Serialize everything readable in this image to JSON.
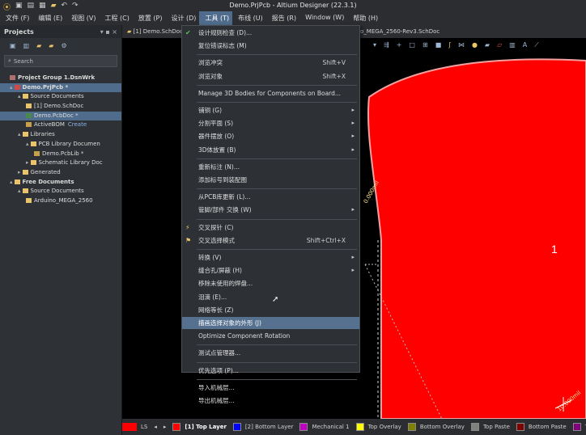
{
  "app": {
    "title": "Demo.PrjPcb - Altium Designer (22.3.1)"
  },
  "menubar": {
    "items": [
      {
        "label": "文件 (F)"
      },
      {
        "label": "编辑 (E)"
      },
      {
        "label": "视图 (V)"
      },
      {
        "label": "工程 (C)"
      },
      {
        "label": "放置 (P)"
      },
      {
        "label": "设计 (D)"
      },
      {
        "label": "工具 (T)",
        "active": true
      },
      {
        "label": "布线 (U)"
      },
      {
        "label": "报告 (R)"
      },
      {
        "label": "Window (W)"
      },
      {
        "label": "帮助 (H)"
      }
    ]
  },
  "projects_panel": {
    "title": "Projects",
    "controls": "▾ ▪ ×",
    "search_placeholder": "Search",
    "tree": [
      {
        "label": "Project Group 1.DsnWrk",
        "indent": 0,
        "bold": true,
        "icon": "workspace-icon"
      },
      {
        "label": "Demo.PrjPcb *",
        "indent": 0,
        "bold": true,
        "selected": true,
        "arrow": "▴",
        "icon": "project-icon"
      },
      {
        "label": "Source Documents",
        "indent": 1,
        "arrow": "▴",
        "icon": "folder-icon"
      },
      {
        "label": "[1] Demo.SchDoc",
        "indent": 2,
        "icon": "schematic-icon"
      },
      {
        "label": "Demo.PcbDoc *",
        "indent": 2,
        "selected": true,
        "icon": "pcb-icon"
      },
      {
        "label": "ActiveBOM",
        "indent": 2,
        "extra": "Create",
        "icon": "bom-icon"
      },
      {
        "label": "Libraries",
        "indent": 1,
        "arrow": "▴",
        "icon": "folder-icon"
      },
      {
        "label": "PCB Library Documen",
        "indent": 2,
        "arrow": "▴",
        "icon": "folder-icon"
      },
      {
        "label": "Demo.PcbLib *",
        "indent": 3,
        "icon": "pcblib-icon"
      },
      {
        "label": "Schematic Library Doc",
        "indent": 2,
        "arrow": "▸",
        "icon": "folder-icon"
      },
      {
        "label": "Generated",
        "indent": 1,
        "arrow": "▸",
        "icon": "folder-icon"
      },
      {
        "label": "Free Documents",
        "indent": 0,
        "bold": true,
        "arrow": "▴",
        "icon": "folder-icon"
      },
      {
        "label": "Source Documents",
        "indent": 1,
        "arrow": "▴",
        "icon": "folder-icon"
      },
      {
        "label": "Arduino_MEGA_2560",
        "indent": 2,
        "icon": "schematic-icon"
      }
    ]
  },
  "doc_tabs": [
    {
      "label": "[1] Demo.SchDoc"
    },
    {
      "label": "o_MEGA_2560-Rev3.SchDoc"
    }
  ],
  "tools_menu": {
    "items": [
      {
        "label": "设计规则检查 (D)...",
        "icon": "check-icon"
      },
      {
        "label": "复位错误标志 (M)"
      },
      {
        "sep": true
      },
      {
        "label": "浏览冲突",
        "shortcut": "Shift+V"
      },
      {
        "label": "浏览对象",
        "shortcut": "Shift+X"
      },
      {
        "sep": true
      },
      {
        "label": "Manage 3D Bodies for Components on Board..."
      },
      {
        "sep": true
      },
      {
        "label": "铺铜 (G)",
        "submenu": true
      },
      {
        "label": "分割平面 (S)",
        "submenu": true
      },
      {
        "label": "器件摆放 (O)",
        "submenu": true
      },
      {
        "label": "3D体放置 (B)",
        "submenu": true
      },
      {
        "sep": true
      },
      {
        "label": "重新标注 (N)..."
      },
      {
        "label": "添加标号到装配图"
      },
      {
        "sep": true
      },
      {
        "label": "从PCB库更新 (L)..."
      },
      {
        "label": "管脚/部件 交换 (W)",
        "submenu": true
      },
      {
        "sep": true
      },
      {
        "label": "交叉探针 (C)",
        "icon": "probe-icon"
      },
      {
        "label": "交叉选择模式",
        "shortcut": "Shift+Ctrl+X",
        "icon": "cross-select-icon"
      },
      {
        "sep": true
      },
      {
        "label": "转换 (V)",
        "submenu": true
      },
      {
        "label": "缝合孔/屏蔽 (H)",
        "submenu": true
      },
      {
        "label": "移除未使用的焊盘..."
      },
      {
        "label": "泪滴 (E)..."
      },
      {
        "label": "网络等长 (Z)"
      },
      {
        "label": "描画选择对象的外形 (J)",
        "highlighted": true
      },
      {
        "label": "Optimize Component Rotation"
      },
      {
        "sep": true
      },
      {
        "label": "测试点管理器..."
      },
      {
        "sep": true
      },
      {
        "label": "优先选项 (P)..."
      },
      {
        "sep": true
      },
      {
        "label": "导入机械层..."
      },
      {
        "label": "导出机械层..."
      }
    ]
  },
  "canvas": {
    "board_label": "1",
    "board_color": "#ff0000",
    "edge_text_1": "0.000mil",
    "edge_text_2": "10.000mil"
  },
  "status_bar": {
    "ls_label": "LS",
    "layers": [
      {
        "name": "[1] Top Layer",
        "color": "#ff0000",
        "active": true
      },
      {
        "name": "[2] Bottom Layer",
        "color": "#0000ff"
      },
      {
        "name": "Mechanical 1",
        "color": "#c000c0"
      },
      {
        "name": "Top Overlay",
        "color": "#ffff00"
      },
      {
        "name": "Bottom Overlay",
        "color": "#808000"
      },
      {
        "name": "Top Paste",
        "color": "#808080"
      },
      {
        "name": "Bottom Paste",
        "color": "#800000"
      },
      {
        "name": "Top Solder",
        "color": "#800080"
      }
    ]
  }
}
